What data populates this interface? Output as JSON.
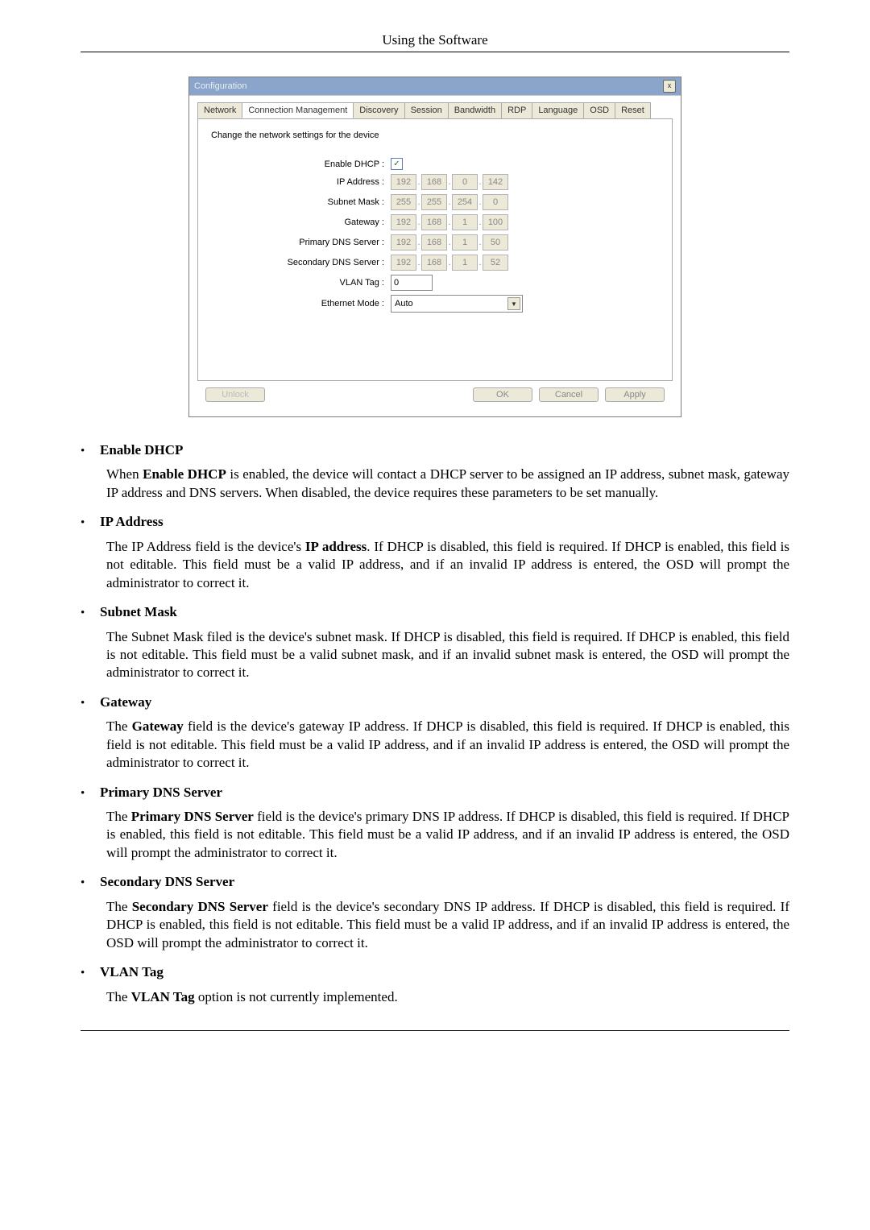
{
  "page_header": "Using the Software",
  "dialog": {
    "title": "Configuration",
    "tabs": [
      "Network",
      "Connection Management",
      "Discovery",
      "Session",
      "Bandwidth",
      "RDP",
      "Language",
      "OSD",
      "Reset"
    ],
    "active_tab": "Connection Management",
    "description": "Change the network settings for the device",
    "fields": {
      "enable_dhcp_label": "Enable DHCP :",
      "enable_dhcp_checked": "✓",
      "ip_address_label": "IP Address :",
      "ip_address": [
        "192",
        "168",
        "0",
        "142"
      ],
      "subnet_label": "Subnet Mask :",
      "subnet": [
        "255",
        "255",
        "254",
        "0"
      ],
      "gateway_label": "Gateway :",
      "gateway": [
        "192",
        "168",
        "1",
        "100"
      ],
      "primary_dns_label": "Primary DNS Server :",
      "primary_dns": [
        "192",
        "168",
        "1",
        "50"
      ],
      "secondary_dns_label": "Secondary DNS Server :",
      "secondary_dns": [
        "192",
        "168",
        "1",
        "52"
      ],
      "vlan_label": "VLAN Tag :",
      "vlan_value": "0",
      "ethernet_label": "Ethernet Mode :",
      "ethernet_value": "Auto"
    },
    "buttons": {
      "unlock": "Unlock",
      "ok": "OK",
      "cancel": "Cancel",
      "apply": "Apply"
    }
  },
  "doc": {
    "items": [
      {
        "title": "Enable DHCP",
        "html": "When <b>Enable DHCP</b> is enabled, the device will contact a DHCP server to be assigned an IP address, subnet mask, gateway IP address and DNS servers. When disabled, the device requires these parameters to be set manually."
      },
      {
        "title": "IP Address",
        "html": "The IP Address field is the device's <b>IP address</b>. If DHCP is disabled, this field is required. If DHCP is enabled, this field is not editable. This field must be a valid IP address, and if an invalid IP address is entered, the OSD will prompt the administrator to correct it."
      },
      {
        "title": "Subnet Mask",
        "html": "The Subnet Mask filed is the device's subnet mask. If DHCP is disabled, this field is required. If DHCP is enabled, this field is not editable. This field must be a valid subnet mask, and if an invalid subnet mask is entered, the OSD will prompt the administrator to correct it."
      },
      {
        "title": "Gateway",
        "html": "The <b>Gateway</b> field is the device's gateway IP address. If DHCP is disabled, this field is required. If DHCP is enabled, this field is not editable. This field must be a valid IP address, and if an invalid IP address is entered, the OSD will prompt the administrator to correct it."
      },
      {
        "title": "Primary DNS Server",
        "html": "The <b>Primary DNS Server</b> field is the device's primary DNS IP address. If DHCP is disabled, this field is required. If DHCP is enabled, this field is not editable. This field must be a valid IP address, and if an invalid IP address is entered, the OSD will prompt the administrator to correct it."
      },
      {
        "title": "Secondary DNS Server",
        "html": "The <b>Secondary DNS Server</b> field is the device's secondary DNS IP address. If DHCP is disabled, this field is required. If DHCP is enabled, this field is not editable. This field must be a valid IP address, and if an invalid IP address is entered, the OSD will prompt the administrator to correct it."
      },
      {
        "title": "VLAN Tag",
        "html": "The <b>VLAN Tag</b> option is not currently implemented."
      }
    ]
  }
}
